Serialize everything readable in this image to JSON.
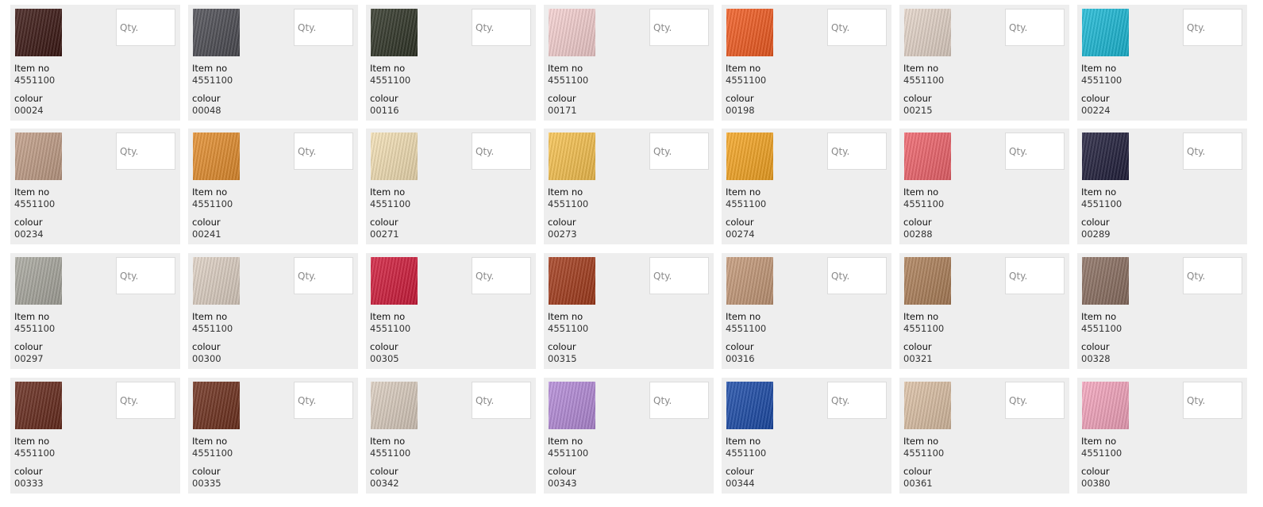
{
  "labels": {
    "item_no": "Item no",
    "colour": "colour",
    "qty_placeholder": "Qty."
  },
  "products": [
    {
      "item_no": "4551100",
      "colour": "00024",
      "swatch": "#3a1612"
    },
    {
      "item_no": "4551100",
      "colour": "00048",
      "swatch": "#4b4b52"
    },
    {
      "item_no": "4551100",
      "colour": "00116",
      "swatch": "#2e3325"
    },
    {
      "item_no": "4551100",
      "colour": "00171",
      "swatch": "#f6d0d0"
    },
    {
      "item_no": "4551100",
      "colour": "00198",
      "swatch": "#f25a1f"
    },
    {
      "item_no": "4551100",
      "colour": "00215",
      "swatch": "#e4d4c8"
    },
    {
      "item_no": "4551100",
      "colour": "00224",
      "swatch": "#19b9d6"
    },
    {
      "item_no": "4551100",
      "colour": "00234",
      "swatch": "#c19d86"
    },
    {
      "item_no": "4551100",
      "colour": "00241",
      "swatch": "#e48d2c"
    },
    {
      "item_no": "4551100",
      "colour": "00271",
      "swatch": "#f4e0b4"
    },
    {
      "item_no": "4551100",
      "colour": "00273",
      "swatch": "#f8c24e"
    },
    {
      "item_no": "4551100",
      "colour": "00274",
      "swatch": "#f6a521"
    },
    {
      "item_no": "4551100",
      "colour": "00288",
      "swatch": "#f0636b"
    },
    {
      "item_no": "4551100",
      "colour": "00289",
      "swatch": "#1f1d3a"
    },
    {
      "item_no": "4551100",
      "colour": "00297",
      "swatch": "#a8a79e"
    },
    {
      "item_no": "4551100",
      "colour": "00300",
      "swatch": "#ded0c3"
    },
    {
      "item_no": "4551100",
      "colour": "00305",
      "swatch": "#d11a3a"
    },
    {
      "item_no": "4551100",
      "colour": "00315",
      "swatch": "#a33a1a"
    },
    {
      "item_no": "4551100",
      "colour": "00316",
      "swatch": "#c49877"
    },
    {
      "item_no": "4551100",
      "colour": "00321",
      "swatch": "#ad7f58"
    },
    {
      "item_no": "4551100",
      "colour": "00328",
      "swatch": "#8a6e60"
    },
    {
      "item_no": "4551100",
      "colour": "00333",
      "swatch": "#66291b"
    },
    {
      "item_no": "4551100",
      "colour": "00335",
      "swatch": "#6e2f1c"
    },
    {
      "item_no": "4551100",
      "colour": "00342",
      "swatch": "#dbcdbf"
    },
    {
      "item_no": "4551100",
      "colour": "00343",
      "swatch": "#b48ad8"
    },
    {
      "item_no": "4551100",
      "colour": "00344",
      "swatch": "#1a4aa8"
    },
    {
      "item_no": "4551100",
      "colour": "00361",
      "swatch": "#dcc0a4"
    },
    {
      "item_no": "4551100",
      "colour": "00380",
      "swatch": "#f5a4bd"
    }
  ]
}
